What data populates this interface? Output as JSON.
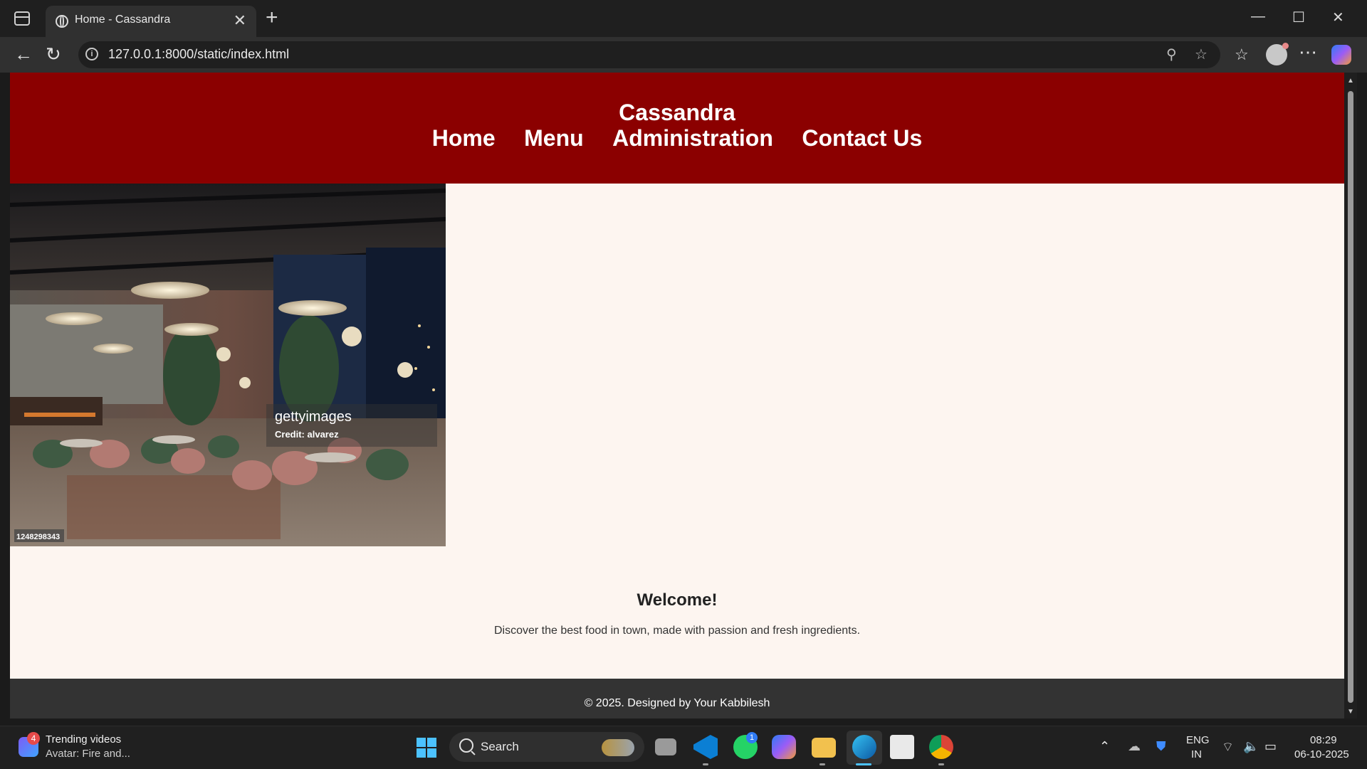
{
  "browser": {
    "tab_title": "Home - Cassandra",
    "url": "127.0.0.1:8000/static/index.html"
  },
  "site": {
    "brand": "Cassandra",
    "nav": [
      "Home",
      "Menu",
      "Administration",
      "Contact Us"
    ],
    "hero": {
      "watermark_brand": "gettyimages",
      "watermark_credit": "Credit: alvarez",
      "image_id": "1248298343"
    },
    "welcome_title": "Welcome!",
    "welcome_text": "Discover the best food in town, made with passion and fresh ingredients.",
    "footer": "© 2025. Designed by Your Kabbilesh",
    "colors": {
      "header": "#8b0000",
      "page": "#fdf5f0",
      "footer": "#333333"
    }
  },
  "taskbar": {
    "widget_badge": "4",
    "widget_title": "Trending videos",
    "widget_subtitle": "Avatar: Fire and...",
    "search_label": "Search",
    "whatsapp_badge": "1",
    "lang_primary": "ENG",
    "lang_secondary": "IN",
    "time": "08:29",
    "date": "06-10-2025"
  },
  "icons": [
    "sidebar-toggle-icon",
    "globe-icon",
    "close-icon",
    "plus-icon",
    "back-arrow-icon",
    "reload-icon",
    "info-icon",
    "zoom-icon",
    "star-icon",
    "favorites-icon",
    "profile-icon",
    "more-icon",
    "copilot-icon",
    "windows-start-icon",
    "search-icon"
  ]
}
